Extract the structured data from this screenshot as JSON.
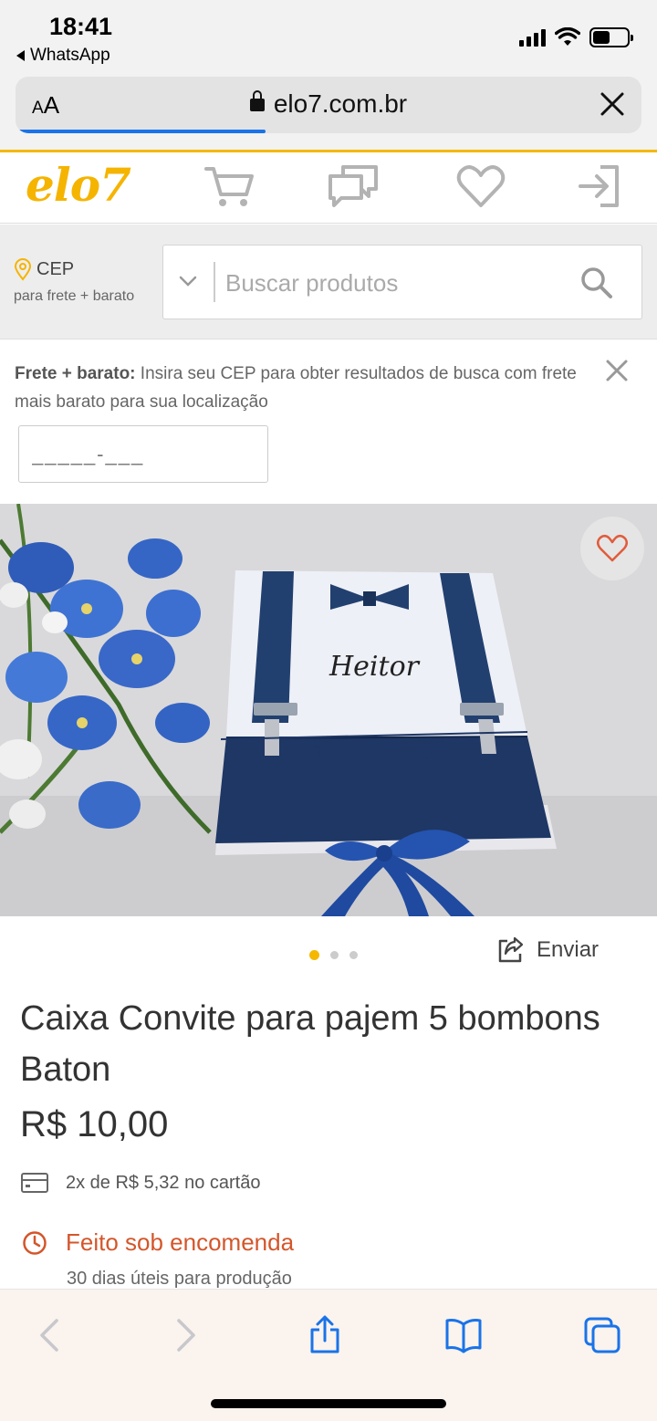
{
  "status_bar": {
    "time": "18:41",
    "back_app": "WhatsApp"
  },
  "browser": {
    "text_size_label_small": "A",
    "text_size_label_large": "A",
    "url": "elo7.com.br",
    "load_progress": 0.4
  },
  "header": {
    "logo": "elo7",
    "icons": [
      "cart-icon",
      "messages-icon",
      "heart-icon",
      "login-icon"
    ]
  },
  "search": {
    "cep_label": "CEP",
    "cep_sublabel": "para frete + barato",
    "placeholder": "Buscar produtos"
  },
  "frete_banner": {
    "title": "Frete + barato:",
    "message": "Insira seu CEP para obter resultados de busca com frete mais barato para sua localização",
    "cep_placeholder": "_____-___"
  },
  "product": {
    "image_text": "Heitor",
    "carousel": {
      "total": 3,
      "active": 0
    },
    "share_label": "Enviar",
    "title": "Caixa Convite para pajem 5 bombons Baton",
    "price": "R$ 10,00",
    "installments": "2x de R$ 5,32 no cartão",
    "made_to_order": "Feito sob encomenda",
    "production_time": "30 dias úteis para produção"
  },
  "colors": {
    "brand": "#f5b400",
    "accent_orange": "#d4562a",
    "ios_blue": "#1a73e8",
    "navy": "#1e3765"
  }
}
